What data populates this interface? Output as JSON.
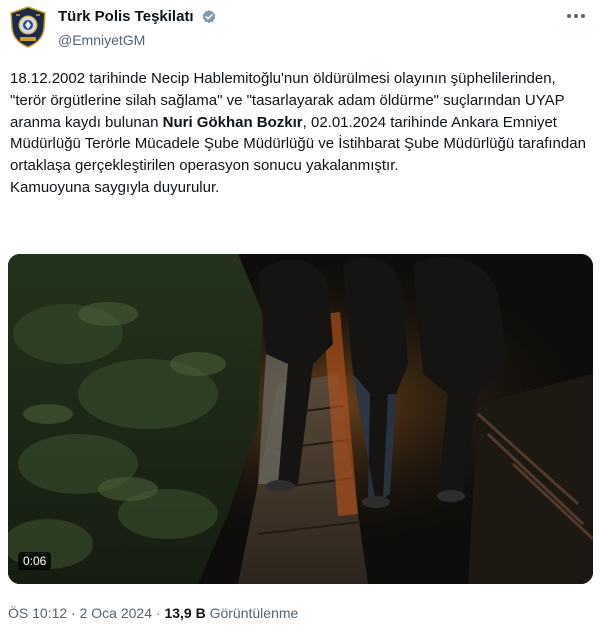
{
  "author": {
    "display_name": "Türk Polis Teşkilatı",
    "handle": "@EmniyetGM",
    "avatar_icon": "police-emblem-icon",
    "verified_icon": "verified-badge-icon",
    "verified_color": "#829aab"
  },
  "tweet": {
    "text_part1": "18.12.2002 tarihinde Necip Hablemitoğlu'nun öldürülmesi olayının şüphelilerinden, \"terör örgütlerine silah sağlama\" ve \"tasarlayarak adam öldürme\" suçlarından UYAP aranma kaydı bulunan ",
    "text_bold": "Nuri Gökhan Bozkır",
    "text_part2": ", 02.01.2024 tarihinde Ankara Emniyet Müdürlüğü Terörle Mücadele Şube Müdürlüğü ve İstihbarat Şube Müdürlüğü tarafından ortaklaşa gerçekleştirilen operasyon sonucu yakalanmıştır.",
    "text_line2": "Kamuoyuna saygıyla duyurulur."
  },
  "video": {
    "timestamp": "0:06"
  },
  "meta": {
    "time": "ÖS 10:12",
    "separator": "·",
    "date": "2 Oca 2024",
    "views_count": "13,9 B",
    "views_label": "Görüntülenme"
  }
}
